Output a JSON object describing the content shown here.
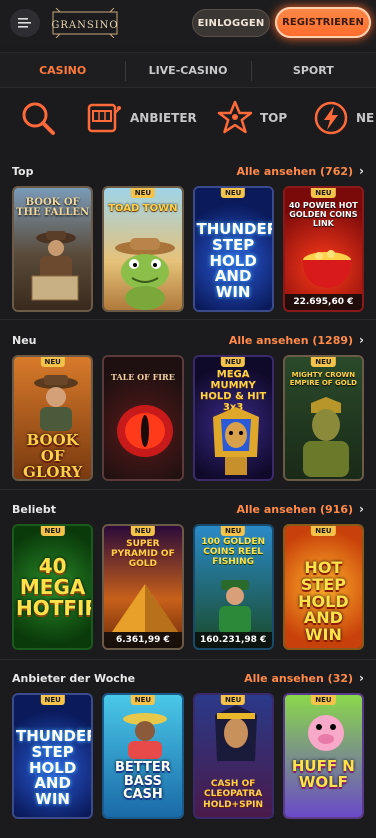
{
  "header": {
    "brand": "GRANSINO",
    "login_label": "EINLOGGEN",
    "register_label": "REGISTRIEREN"
  },
  "tabs": [
    "CASINO",
    "LIVE-CASINO",
    "SPORT"
  ],
  "categories": [
    {
      "icon": "search-icon",
      "label": ""
    },
    {
      "icon": "slot-machine-icon",
      "label": "ANBIETER"
    },
    {
      "icon": "star-icon",
      "label": "TOP"
    },
    {
      "icon": "lightning-icon",
      "label": "NE"
    }
  ],
  "sections": [
    {
      "title": "Top",
      "link": "Alle ansehen (762)",
      "games": [
        {
          "name": "BOOK OF THE FALLEN",
          "badge": "",
          "jackpot": ""
        },
        {
          "name": "TOAD TOWN",
          "badge": "NEU",
          "jackpot": ""
        },
        {
          "name": "THUNDER STEP HOLD AND WIN",
          "badge": "NEU",
          "jackpot": ""
        },
        {
          "name": "40 POWER HOT GOLDEN COINS LINK",
          "badge": "NEU",
          "jackpot": "22.695,60 €"
        }
      ]
    },
    {
      "title": "Neu",
      "link": "Alle ansehen (1289)",
      "games": [
        {
          "name": "BOOK OF GLORY",
          "badge": "NEU",
          "jackpot": ""
        },
        {
          "name": "TALE OF FIRE",
          "badge": "",
          "jackpot": ""
        },
        {
          "name": "MEGA MUMMY HOLD & HIT 3x3",
          "badge": "NEU",
          "jackpot": ""
        },
        {
          "name": "MIGHTY CROWN EMPIRE OF GOLD",
          "badge": "NEU",
          "jackpot": ""
        }
      ]
    },
    {
      "title": "Beliebt",
      "link": "Alle ansehen (916)",
      "games": [
        {
          "name": "40 MEGA HOTFIRE",
          "badge": "NEU",
          "jackpot": ""
        },
        {
          "name": "SUPER PYRAMID OF GOLD",
          "badge": "NEU",
          "jackpot": "6.361,99 €"
        },
        {
          "name": "100 GOLDEN COINS REEL FISHING",
          "badge": "NEU",
          "jackpot": "160.231,98 €"
        },
        {
          "name": "HOT STEP HOLD AND WIN",
          "badge": "NEU",
          "jackpot": ""
        }
      ]
    },
    {
      "title": "Anbieter der Woche",
      "link": "Alle ansehen (32)",
      "games": [
        {
          "name": "THUNDER STEP HOLD AND WIN",
          "badge": "NEU",
          "jackpot": ""
        },
        {
          "name": "BETTER BASS CASH",
          "badge": "NEU",
          "jackpot": ""
        },
        {
          "name": "CASH OF CLEOPATRA HOLD+SPIN",
          "badge": "NEU",
          "jackpot": ""
        },
        {
          "name": "HUFF N WOLF",
          "badge": "NEU",
          "jackpot": ""
        }
      ]
    }
  ],
  "colors": {
    "accent": "#ff7b3b",
    "background": "#1b1b1d",
    "badge": "#f5c34a"
  }
}
